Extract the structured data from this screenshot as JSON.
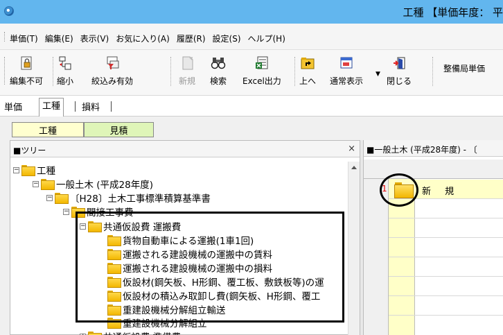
{
  "window": {
    "title": "工種 【単価年度： 平"
  },
  "menubar": {
    "items": [
      "単価(T)",
      "編集(E)",
      "表示(V)",
      "お気に入り(A)",
      "履歴(R)",
      "設定(S)",
      "ヘルプ(H)"
    ]
  },
  "toolbar": {
    "buttons": [
      {
        "label": "編集不可",
        "icon": "lock-icon",
        "enabled": true
      },
      {
        "label": "縮小",
        "icon": "collapse-icon",
        "enabled": true
      },
      {
        "label": "絞込み有効",
        "icon": "filter-icon",
        "enabled": true
      },
      {
        "label": "新規",
        "icon": "new-doc-icon",
        "enabled": false
      },
      {
        "label": "検索",
        "icon": "binoculars-icon",
        "enabled": true
      },
      {
        "label": "Excel出力",
        "icon": "excel-export-icon",
        "enabled": true
      },
      {
        "label": "上へ",
        "icon": "folder-up-icon",
        "enabled": true
      },
      {
        "label": "通常表示",
        "icon": "normal-view-icon",
        "enabled": true
      },
      {
        "label": "閉じる",
        "icon": "close-door-icon",
        "enabled": true
      }
    ],
    "dept_button": "整備局単価"
  },
  "tabs": {
    "items": [
      "単価",
      "工種",
      "損料"
    ],
    "active": "工種"
  },
  "subtabs": {
    "koshu": "工種",
    "mitsumori": "見積"
  },
  "tree_pane": {
    "title": "■ツリー",
    "close": "×",
    "nodes": [
      {
        "label": "工種",
        "expander": "−"
      },
      {
        "label": "一般土木 (平成28年度)",
        "expander": "−"
      },
      {
        "label": "〔H28〕土木工事標準積算基準書",
        "expander": "−"
      },
      {
        "label": "間接工事費",
        "expander": "−"
      },
      {
        "label": "共通仮設費 運搬費",
        "expander": "−"
      },
      {
        "label": "貨物自動車による運搬(1車1回)",
        "expander": ""
      },
      {
        "label": "運搬される建設機械の運搬中の賃料",
        "expander": ""
      },
      {
        "label": "運搬される建設機械の運搬中の損料",
        "expander": ""
      },
      {
        "label": "仮設材(鋼矢板、H形鋼、覆工板、敷鉄板等)の運",
        "expander": ""
      },
      {
        "label": "仮設材の積込み取卸し費(鋼矢板、H形鋼、覆工",
        "expander": ""
      },
      {
        "label": "重建設機械分解組立輸送",
        "expander": ""
      },
      {
        "label": "重建設機械分解組立",
        "expander": ""
      },
      {
        "label": "共通仮設費 準備費",
        "expander": "+"
      }
    ]
  },
  "grid_pane": {
    "title": "■一般土木 (平成28年度) - 〔",
    "rows": [
      {
        "num": "1",
        "label": "新 規"
      }
    ]
  }
}
